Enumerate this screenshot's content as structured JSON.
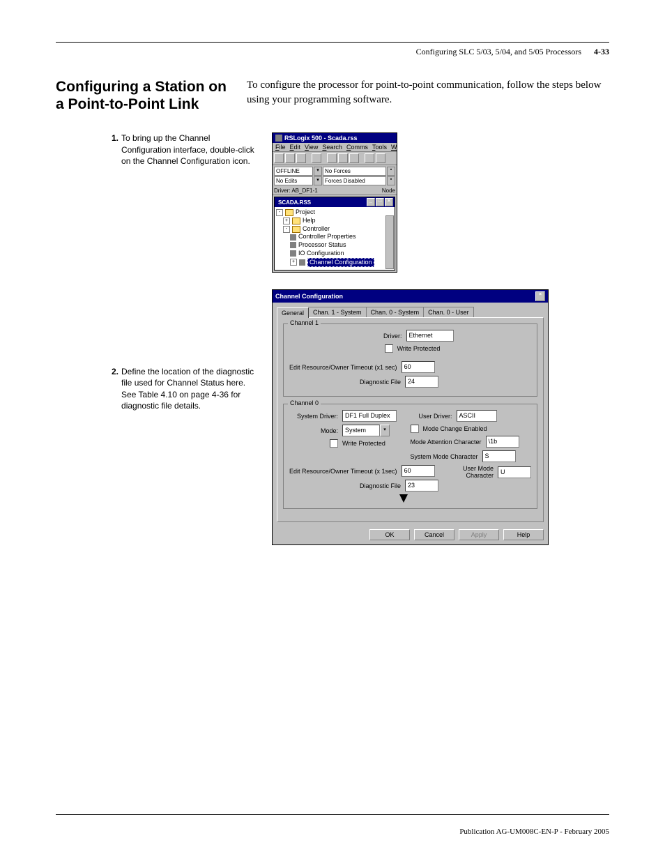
{
  "header": {
    "running_title": "Configuring SLC 5/03, 5/04, and 5/05 Processors",
    "page_number": "4-33"
  },
  "section": {
    "title": "Configuring a Station on a Point-to-Point Link",
    "intro": "To configure the processor for point-to-point communication, follow the steps below using your programming software."
  },
  "steps": {
    "s1_num": "1.",
    "s1_text": "To bring up the Channel Configuration interface, double-click on the Channel Configuration icon.",
    "s2_num": "2.",
    "s2_text": "Define the location of the diagnostic file used for Channel Status here. See Table 4.10 on page 4-36 for diagnostic file details."
  },
  "rslogix": {
    "title": "RSLogix 500 - Scada.rss",
    "menu": {
      "file": "File",
      "edit": "Edit",
      "view": "View",
      "search": "Search",
      "comms": "Comms",
      "tools": "Tools",
      "w": "W"
    },
    "status": {
      "offline": "OFFLINE",
      "no_forces": "No Forces",
      "no_edits": "No Edits",
      "forces_disabled": "Forces Disabled",
      "driver_label": "Driver: AB_DF1-1",
      "node_label": "Node"
    },
    "inner_title": "SCADA.RSS",
    "tree": {
      "project": "Project",
      "help": "Help",
      "controller": "Controller",
      "ctrl_props": "Controller Properties",
      "proc_status": "Processor Status",
      "io_config": "IO Configuration",
      "chan_config": "Channel Configuration"
    }
  },
  "dialog": {
    "title": "Channel Configuration",
    "tabs": {
      "general": "General",
      "c1sys": "Chan. 1 - System",
      "c0sys": "Chan. 0 - System",
      "c0usr": "Chan. 0 - User"
    },
    "ch1": {
      "group": "Channel 1",
      "driver_label": "Driver:",
      "driver_value": "Ethernet",
      "write_protected": "Write Protected",
      "timeout_label": "Edit Resource/Owner Timeout (x1 sec)",
      "timeout_value": "60",
      "diag_label": "Diagnostic File",
      "diag_value": "24"
    },
    "ch0": {
      "group": "Channel 0",
      "sys_driver_label": "System Driver:",
      "sys_driver_value": "DF1 Full Duplex",
      "user_driver_label": "User Driver:",
      "user_driver_value": "ASCII",
      "mode_label": "Mode:",
      "mode_value": "System",
      "mode_change_enabled": "Mode Change Enabled",
      "write_protected": "Write Protected",
      "mode_attn_label": "Mode Attention Character",
      "mode_attn_value": "\\1b",
      "sys_mode_char_label": "System Mode Character",
      "sys_mode_char_value": "S",
      "timeout_label": "Edit Resource/Owner Timeout (x 1sec)",
      "timeout_value": "60",
      "user_mode_char_label": "User Mode Character",
      "user_mode_char_value": "U",
      "diag_label": "Diagnostic File",
      "diag_value": "23"
    },
    "buttons": {
      "ok": "OK",
      "cancel": "Cancel",
      "apply": "Apply",
      "help": "Help"
    }
  },
  "footer": {
    "text": "Publication AG-UM008C-EN-P - February 2005"
  }
}
